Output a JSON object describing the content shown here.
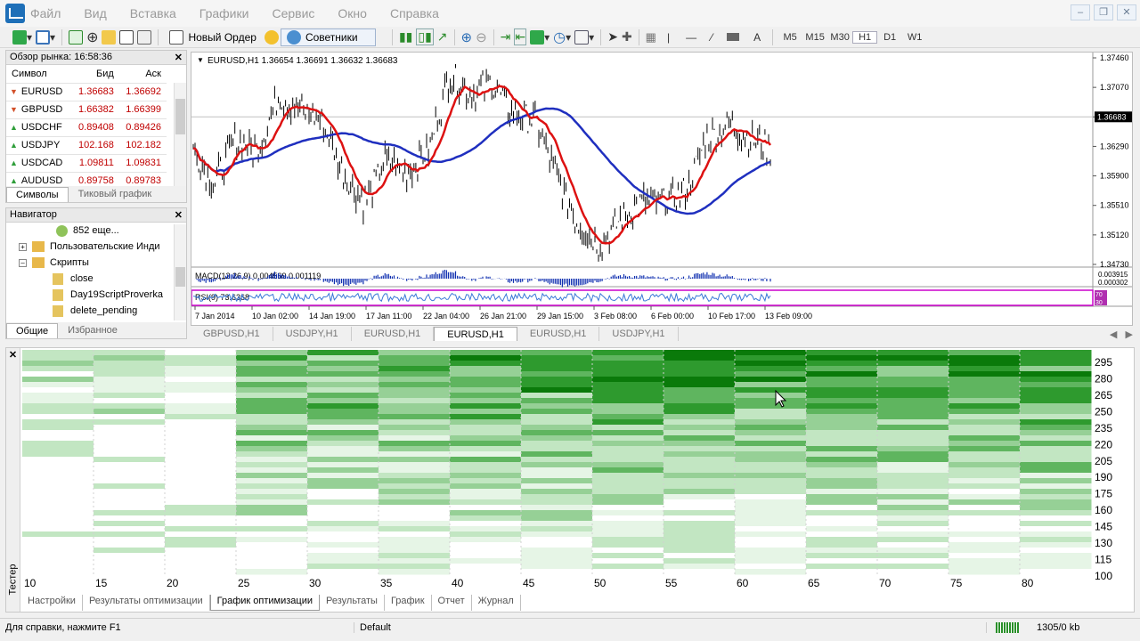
{
  "menu": [
    "Файл",
    "Вид",
    "Вставка",
    "Графики",
    "Сервис",
    "Окно",
    "Справка"
  ],
  "toolbar": {
    "new_order": "Новый Ордер",
    "advisors": "Советники",
    "timeframes": [
      "M5",
      "M15",
      "M30",
      "H1",
      "D1",
      "W1"
    ]
  },
  "market_watch": {
    "title": "Обзор рынка: 16:58:36",
    "col_symbol": "Символ",
    "col_bid": "Бид",
    "col_ask": "Аск",
    "rows": [
      {
        "symbol": "EURUSD",
        "bid": "1.36683",
        "ask": "1.36692",
        "dir": "down"
      },
      {
        "symbol": "GBPUSD",
        "bid": "1.66382",
        "ask": "1.66399",
        "dir": "down"
      },
      {
        "symbol": "USDCHF",
        "bid": "0.89408",
        "ask": "0.89426",
        "dir": "up"
      },
      {
        "symbol": "USDJPY",
        "bid": "102.168",
        "ask": "102.182",
        "dir": "up"
      },
      {
        "symbol": "USDCAD",
        "bid": "1.09811",
        "ask": "1.09831",
        "dir": "up"
      },
      {
        "symbol": "AUDUSD",
        "bid": "0.89758",
        "ask": "0.89783",
        "dir": "up"
      }
    ],
    "tabs": [
      "Символы",
      "Тиковый график"
    ]
  },
  "navigator": {
    "title": "Навигатор",
    "items": [
      "852 еще...",
      "Пользовательские Инди",
      "Скрипты",
      "close",
      "Day19ScriptProverka",
      "delete_pending"
    ],
    "tabs": [
      "Общие",
      "Избранное"
    ]
  },
  "chart": {
    "header": "EURUSD,H1  1.36654 1.36691 1.36632 1.36683",
    "macd_label": "MACD(12,26,9) 0.004569 0.001119",
    "rsi_label": "RSI(9) 73.6368",
    "current_price": "1.36683",
    "price_ticks": [
      "1.37460",
      "1.37070",
      "1.36683",
      "1.36290",
      "1.35900",
      "1.35510",
      "1.35120",
      "1.34730"
    ],
    "macd_ticks": [
      "0.003915",
      "0.000302"
    ],
    "rsi_ticks": [
      "70",
      "30"
    ],
    "time_ticks": [
      "7 Jan 2014",
      "10 Jan 02:00",
      "14 Jan 19:00",
      "17 Jan 11:00",
      "22 Jan 04:00",
      "26 Jan 21:00",
      "29 Jan 15:00",
      "3 Feb 08:00",
      "6 Feb 00:00",
      "10 Feb 17:00",
      "13 Feb 09:00"
    ],
    "colors": {
      "ma_fast": "#dd1111",
      "ma_slow": "#1f2fbf",
      "macd": "#1030b0",
      "rsi": "#3a78d8",
      "rsi_bg": "#cc00cc"
    }
  },
  "chart_tabs": [
    "GBPUSD,H1",
    "USDJPY,H1",
    "EURUSD,H1",
    "EURUSD,H1",
    "EURUSD,H1",
    "USDJPY,H1"
  ],
  "chart_tab_active": 3,
  "tester": {
    "side_label": "Тестер",
    "y_ticks": [
      "295",
      "280",
      "265",
      "250",
      "235",
      "220",
      "205",
      "190",
      "175",
      "160",
      "145",
      "130",
      "115",
      "100"
    ],
    "x_ticks": [
      "10",
      "15",
      "20",
      "25",
      "30",
      "35",
      "40",
      "45",
      "50",
      "55",
      "60",
      "65",
      "70",
      "75",
      "80"
    ],
    "tabs": [
      "Настройки",
      "Результаты оптимизации",
      "График оптимизации",
      "Результаты",
      "График",
      "Отчет",
      "Журнал"
    ],
    "active_tab": 2,
    "heat_colors": [
      "#ffffff",
      "#e6f5e6",
      "#c2e6c2",
      "#96d096",
      "#5fb55f",
      "#2e9a2e",
      "#0a7a0a"
    ]
  },
  "status": {
    "help": "Для справки, нажмите F1",
    "profile": "Default",
    "traffic": "1305/0 kb"
  }
}
